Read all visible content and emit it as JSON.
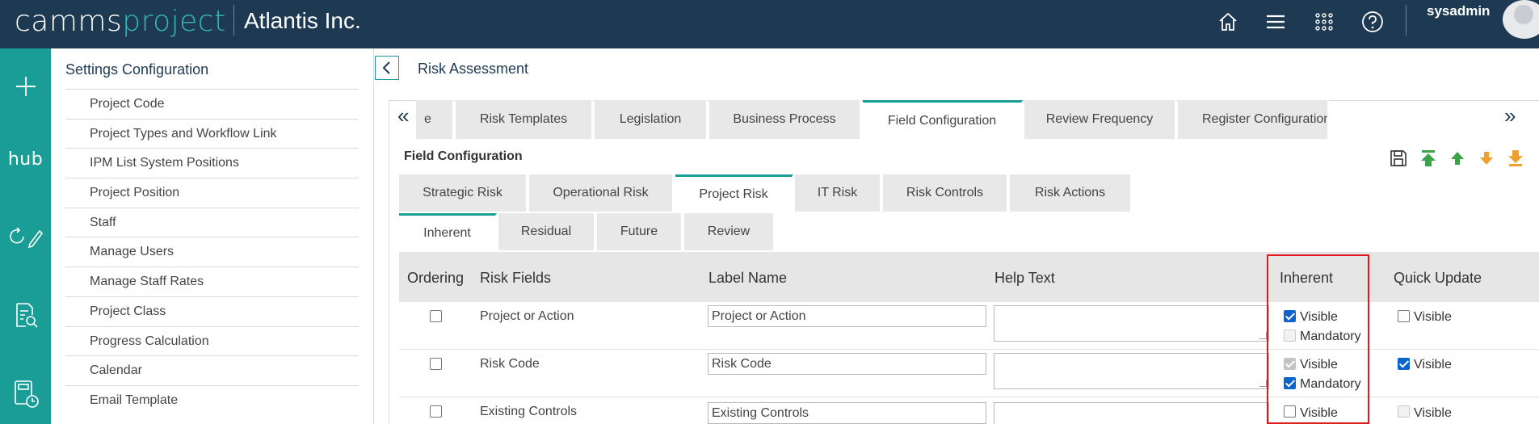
{
  "header": {
    "logo_part1": "camms",
    "logo_part2": "project",
    "company": "Atlantis Inc.",
    "username": "sysadmin",
    "icons": [
      "home-icon",
      "menu-icon",
      "apps-grid-icon",
      "help-icon"
    ]
  },
  "rail": {
    "hub_label": "hub",
    "icons": [
      "add-icon",
      "hub-logo",
      "refresh-edit-icon",
      "document-search-icon",
      "calculator-clock-icon"
    ]
  },
  "settings": {
    "title": "Settings Configuration",
    "items": [
      "Project Code",
      "Project Types and Workflow Link",
      "IPM List System Positions",
      "Project Position",
      "Staff",
      "Manage Users",
      "Manage Staff Rates",
      "Project Class",
      "Progress Calculation",
      "Calendar",
      "Email Template"
    ]
  },
  "main": {
    "title": "Risk Assessment",
    "top_tabs": [
      {
        "label": "e",
        "active": false
      },
      {
        "label": "Risk Templates",
        "active": false
      },
      {
        "label": "Legislation",
        "active": false
      },
      {
        "label": "Business Process",
        "active": false
      },
      {
        "label": "Field Configuration",
        "active": true
      },
      {
        "label": "Review Frequency",
        "active": false
      },
      {
        "label": "Register Configuration",
        "active": false
      }
    ],
    "section_label": "Field Configuration",
    "toolbar_icons": [
      "save-icon",
      "move-top-icon",
      "move-up-icon",
      "move-down-icon",
      "move-bottom-icon"
    ],
    "risk_tabs": [
      {
        "label": "Strategic Risk",
        "active": false
      },
      {
        "label": "Operational Risk",
        "active": false
      },
      {
        "label": "Project Risk",
        "active": true
      },
      {
        "label": "IT Risk",
        "active": false
      },
      {
        "label": "Risk Controls",
        "active": false
      },
      {
        "label": "Risk Actions",
        "active": false
      }
    ],
    "phase_tabs": [
      {
        "label": "Inherent",
        "active": true
      },
      {
        "label": "Residual",
        "active": false
      },
      {
        "label": "Future",
        "active": false
      },
      {
        "label": "Review",
        "active": false
      }
    ],
    "columns": [
      "Ordering",
      "Risk Fields",
      "Label Name",
      "Help Text",
      "Inherent",
      "Quick Update"
    ],
    "rows": [
      {
        "field": "Project or Action",
        "label": "Project or Action",
        "inherent_visible": {
          "label": "Visible",
          "checked": true,
          "disabled": false
        },
        "inherent_mandatory": {
          "label": "Mandatory",
          "checked": false,
          "disabled": true
        },
        "quick_visible": {
          "label": "Visible",
          "checked": false,
          "disabled": false
        }
      },
      {
        "field": "Risk Code",
        "label": "Risk Code",
        "inherent_visible": {
          "label": "Visible",
          "checked": true,
          "disabled": true
        },
        "inherent_mandatory": {
          "label": "Mandatory",
          "checked": true,
          "disabled": false
        },
        "quick_visible": {
          "label": "Visible",
          "checked": true,
          "disabled": false
        }
      },
      {
        "field": "Existing Controls",
        "label": "Existing Controls",
        "inherent_visible": {
          "label": "Visible",
          "checked": false,
          "disabled": false
        },
        "quick_visible": {
          "label": "Visible",
          "checked": false,
          "disabled": true
        }
      }
    ]
  },
  "colors": {
    "header_bg": "#1e3a52",
    "accent": "#1a9d96",
    "highlight_border": "#e0191f",
    "checkbox_checked": "#0b63ce"
  }
}
